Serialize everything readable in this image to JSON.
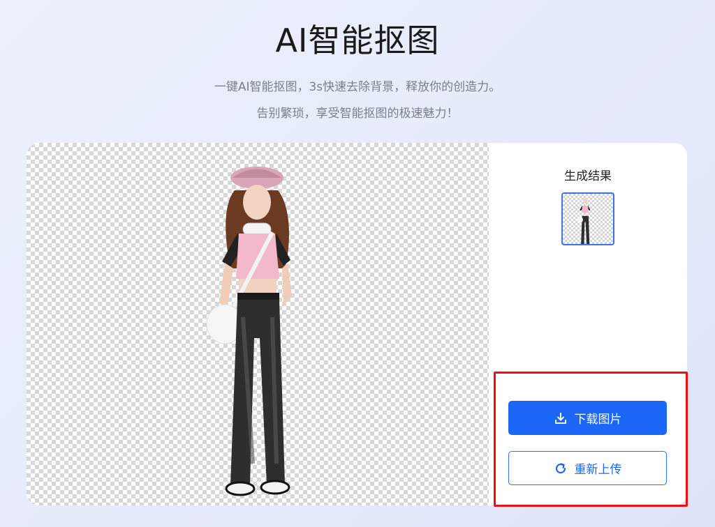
{
  "header": {
    "title": "AI智能抠图",
    "subtitle_line1": "一键AI智能抠图，3s快速去除背景，释放你的创造力。",
    "subtitle_line2": "告别繁琐，享受智能抠图的极速魅力！"
  },
  "result_panel": {
    "title": "生成结果",
    "thumbnail_icon": "cutout-person-thumbnail"
  },
  "actions": {
    "download_label": "下载图片",
    "download_icon": "download-icon",
    "reupload_label": "重新上传",
    "reupload_icon": "refresh-icon"
  },
  "colors": {
    "accent": "#1b67f8",
    "highlight_box": "#ee1111"
  }
}
